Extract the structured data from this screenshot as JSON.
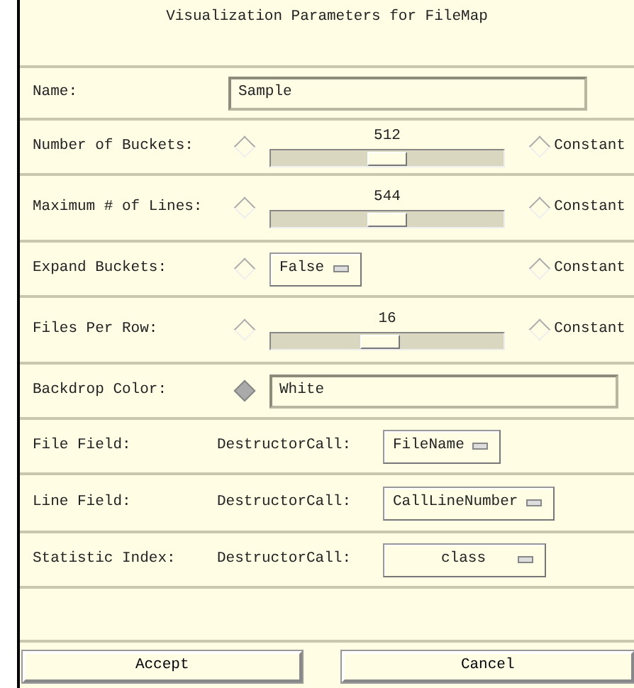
{
  "window": {
    "title": "Visualization Parameters for FileMap"
  },
  "rows": [
    {
      "kind": "text",
      "label": "Name:",
      "value": "Sample"
    },
    {
      "kind": "slider",
      "label": "Number of Buckets:",
      "toggle_selected": false,
      "reading": "512",
      "level": 0.5,
      "constant": {
        "label": "Constant",
        "selected": false
      }
    },
    {
      "kind": "slider",
      "label": "Maximum # of Lines:",
      "toggle_selected": false,
      "reading": "544",
      "level": 0.5,
      "constant": {
        "label": "Constant",
        "selected": false
      }
    },
    {
      "kind": "menu",
      "label": "Expand Buckets:",
      "toggle_selected": false,
      "value": "False",
      "constant": {
        "label": "Constant",
        "selected": false
      }
    },
    {
      "kind": "slider",
      "label": "Files Per Row:",
      "toggle_selected": false,
      "reading": "16",
      "level": 0.47,
      "constant": {
        "label": "Constant",
        "selected": false
      }
    },
    {
      "kind": "text",
      "label": "Backdrop Color:",
      "toggle_selected": true,
      "value": "White"
    },
    {
      "kind": "call",
      "label": "File Field:",
      "call": "DestructorCall:",
      "value": "FileName"
    },
    {
      "kind": "call",
      "label": "Line Field:",
      "call": "DestructorCall:",
      "value": "CallLineNumber"
    },
    {
      "kind": "call",
      "label": "Statistic Index:",
      "call": "DestructorCall:",
      "value": "class"
    }
  ],
  "buttons": [
    "Accept",
    "Cancel"
  ]
}
